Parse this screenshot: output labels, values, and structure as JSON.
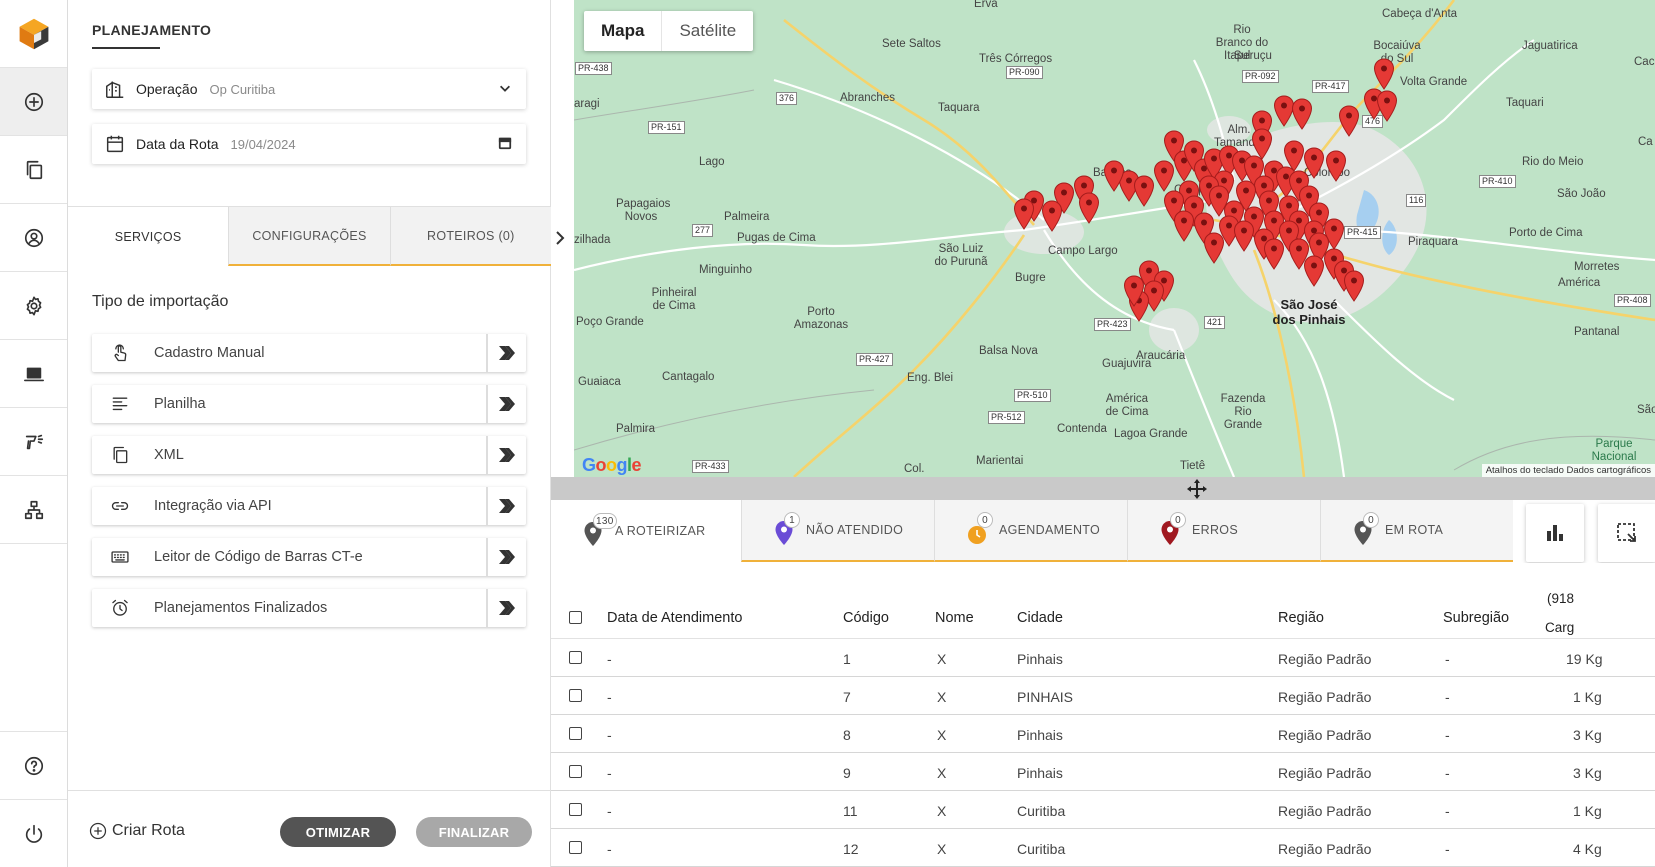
{
  "panel": {
    "title": "PLANEJAMENTO",
    "operacao": {
      "label": "Operação",
      "value": "Op Curitiba"
    },
    "data_rota": {
      "label": "Data da Rota",
      "value": "19/04/2024"
    },
    "tabs": [
      "SERVIÇOS",
      "CONFIGURAÇÕES",
      "ROTEIROS (0)"
    ],
    "section_title": "Tipo de importação",
    "import_items": [
      {
        "label": "Cadastro Manual",
        "icon": "touch-icon"
      },
      {
        "label": "Planilha",
        "icon": "lines-icon"
      },
      {
        "label": "XML",
        "icon": "copy-icon"
      },
      {
        "label": "Integração via API",
        "icon": "link-icon"
      },
      {
        "label": "Leitor de Código de Barras CT-e",
        "icon": "keyboard-icon"
      },
      {
        "label": "Planejamentos Finalizados",
        "icon": "alarm-icon"
      }
    ],
    "footer": {
      "criar_rota": "Criar Rota",
      "otimizar": "OTIMIZAR",
      "finalizar": "FINALIZAR"
    }
  },
  "map": {
    "type_active": "Mapa",
    "type_other": "Satélite",
    "attribution": "Atalhos do teclado  Dados cartográficos",
    "google": [
      "G",
      "o",
      "o",
      "g",
      "l",
      "e"
    ],
    "labels": [
      "Sete Saltos",
      "Três Córregos",
      "Abranches",
      "Taquara",
      "Lago",
      "Bateias",
      "Campo Largo",
      "Papagaios Novos",
      "Palmeira",
      "Pugas de Cima",
      "Minguinho",
      "zilhada",
      "Pinheiral de Cima",
      "Porto Amazonas",
      "São Luiz do Purunã",
      "Bugre",
      "Poço Grande",
      "Balsa Nova",
      "Guajuvira",
      "Eng. Blei",
      "Guaiaca",
      "Cantagalo",
      "América de Cima",
      "Palmira",
      "Contenda",
      "Lagoa Grande",
      "Marientai",
      "Col.",
      "Tietê",
      "Araucária",
      "Fazenda Rio Grande",
      "Alm. Tamandaré",
      "Colombo",
      "Rio Branco do Sul",
      "Itaperuçu",
      "Bocaiúva do Sul",
      "Cabeça d'Anta",
      "Jaguatirica",
      "Volta Grande",
      "Taquari",
      "Rio do Meio",
      "São João",
      "Piraquara",
      "Porto de Cima",
      "Morretes",
      "América",
      "Pantanal",
      "Parque Nacional",
      "Erva",
      "aragi",
      "Campo",
      "São",
      "Cach",
      "Ca"
    ],
    "big_city": "São José dos Pinhais",
    "roads": [
      "PR-438",
      "PR-090",
      "376",
      "PR-151",
      "277",
      "PR-092",
      "PR-417",
      "476",
      "116",
      "PR-410",
      "PR-415",
      "PR-423",
      "421",
      "PR-427",
      "PR-510",
      "PR-512",
      "PR-433",
      "PR-408"
    ]
  },
  "status_tabs": [
    {
      "label": "A ROTEIRIZAR",
      "count": "130",
      "color": "#555555",
      "icon": "map-pin-icon"
    },
    {
      "label": "NÃO ATENDIDO",
      "count": "1",
      "color": "#6a4cd6",
      "icon": "map-pin-icon"
    },
    {
      "label": "AGENDAMENTO",
      "count": "0",
      "color": "#f0a020",
      "icon": "clock-pin-icon"
    },
    {
      "label": "ERROS",
      "count": "0",
      "color": "#a01820",
      "icon": "map-pin-icon"
    },
    {
      "label": "EM ROTA",
      "count": "0",
      "color": "#555555",
      "icon": "map-pin-icon"
    }
  ],
  "table": {
    "columns": [
      "Data de Atendimento",
      "Código",
      "Nome",
      "Cidade",
      "Região",
      "Subregião"
    ],
    "extra_header_top": "(918",
    "extra_header_bottom": "Carg",
    "rows": [
      {
        "data": "-",
        "codigo": "1",
        "nome": "X",
        "cidade": "Pinhais",
        "regiao": "Região Padrão",
        "sub": "-",
        "carga": "19 Kg"
      },
      {
        "data": "-",
        "codigo": "7",
        "nome": "X",
        "cidade": "PINHAIS",
        "regiao": "Região Padrão",
        "sub": "-",
        "carga": "1 Kg"
      },
      {
        "data": "-",
        "codigo": "8",
        "nome": "X",
        "cidade": "Pinhais",
        "regiao": "Região Padrão",
        "sub": "-",
        "carga": "3 Kg"
      },
      {
        "data": "-",
        "codigo": "9",
        "nome": "X",
        "cidade": "Pinhais",
        "regiao": "Região Padrão",
        "sub": "-",
        "carga": "3 Kg"
      },
      {
        "data": "-",
        "codigo": "11",
        "nome": "X",
        "cidade": "Curitiba",
        "regiao": "Região Padrão",
        "sub": "-",
        "carga": "1 Kg"
      },
      {
        "data": "-",
        "codigo": "12",
        "nome": "X",
        "cidade": "Curitiba",
        "regiao": "Região Padrão",
        "sub": "-",
        "carga": "4 Kg"
      }
    ]
  },
  "colors": {
    "accent": "#f0b13a",
    "pin": "#e53935",
    "map_bg": "#bfe3c7"
  }
}
